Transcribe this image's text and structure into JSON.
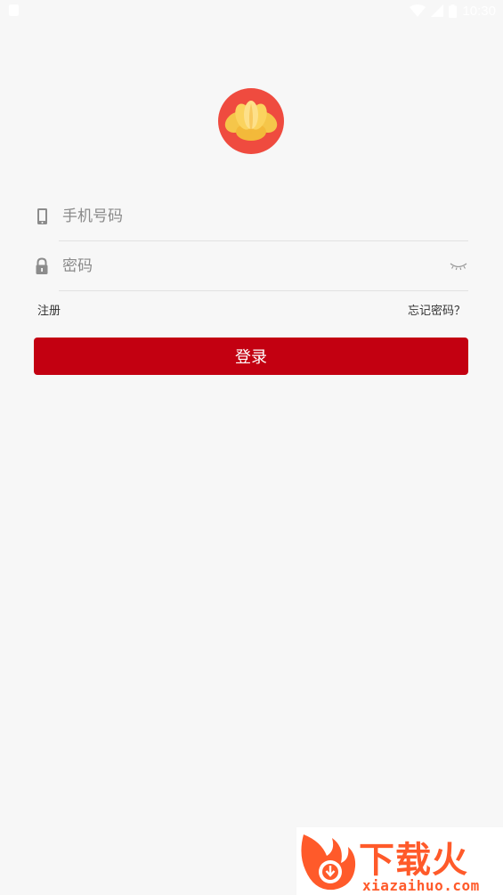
{
  "status_bar": {
    "time": "10:30"
  },
  "form": {
    "phone": {
      "placeholder": "手机号码",
      "value": "",
      "icon": "phone-icon"
    },
    "password": {
      "placeholder": "密码",
      "value": "",
      "icon": "lock-icon",
      "toggle_icon": "eye-closed-icon"
    },
    "register_label": "注册",
    "forgot_label": "忘记密码？",
    "login_label": "登录"
  },
  "watermark": {
    "brand": "下载火",
    "site": "xiazaihuo.com"
  },
  "colors": {
    "background": "#f7f7f7",
    "primary": "#c30011",
    "logo_bg": "#ef4b3f",
    "logo_flower": "#f5c64a",
    "watermark": "#ff5a2a"
  }
}
